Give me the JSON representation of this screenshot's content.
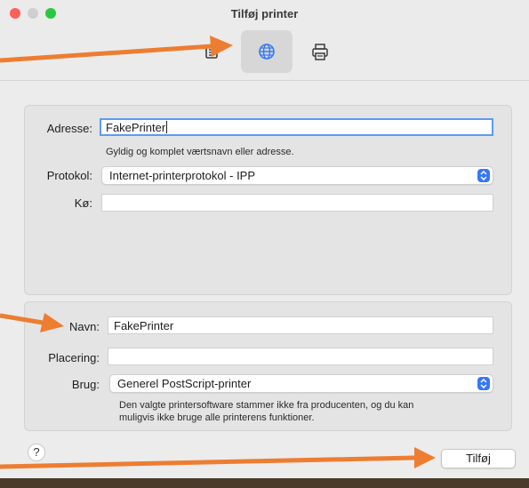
{
  "window": {
    "title": "Tilføj printer"
  },
  "toolbar": {
    "items": [
      {
        "name": "default-printers-tab",
        "icon": "printer-list-icon",
        "selected": false
      },
      {
        "name": "ip-printer-tab",
        "icon": "globe-icon",
        "selected": true
      },
      {
        "name": "windows-printer-tab",
        "icon": "printer-icon",
        "selected": false
      }
    ]
  },
  "form": {
    "address": {
      "label": "Adresse:",
      "value": "FakePrinter",
      "hint": "Gyldig og komplet værtsnavn eller adresse."
    },
    "protocol": {
      "label": "Protokol:",
      "value": "Internet-printerprotokol - IPP"
    },
    "queue": {
      "label": "Kø:",
      "value": ""
    },
    "name": {
      "label": "Navn:",
      "value": "FakePrinter"
    },
    "location": {
      "label": "Placering:",
      "value": ""
    },
    "use": {
      "label": "Brug:",
      "value": "Generel PostScript-printer",
      "note_line1": "Den valgte printersoftware stammer ikke fra producenten, og du kan",
      "note_line2": "muligvis ikke bruge alle printerens funktioner."
    }
  },
  "footer": {
    "help_label": "?",
    "add_label": "Tilføj"
  },
  "colors": {
    "annotation_arrow": "#ed7d31",
    "accent": "#3478f6",
    "focus_ring": "#5b9bf2"
  }
}
